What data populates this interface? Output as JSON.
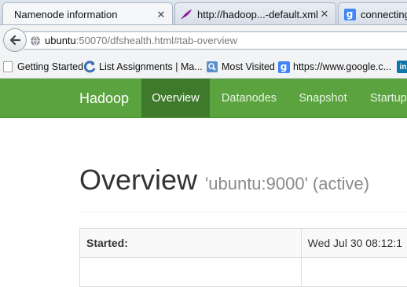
{
  "browser": {
    "tabs": [
      {
        "label": "Namenode information",
        "icon": "none",
        "active": true
      },
      {
        "label": "http://hadoop...-default.xml",
        "icon": "feather-icon",
        "active": false
      },
      {
        "label": "connecting",
        "icon": "google-icon",
        "active": false
      }
    ],
    "close_glyph": "✕",
    "url": {
      "host": "ubuntu",
      "rest": ":50070/dfshealth.html#tab-overview"
    },
    "bookmarks": [
      {
        "label": "Getting Started",
        "icon": "page-icon"
      },
      {
        "label": "List Assignments | Ma...",
        "icon": "swirl-icon"
      },
      {
        "label": "Most Visited",
        "icon": "magnifier-icon"
      },
      {
        "label": "https://www.google.c...",
        "icon": "google-icon"
      }
    ],
    "google_letter": "g",
    "truncated_bookmark_badge": "in"
  },
  "app": {
    "brand": "Hadoop",
    "nav": [
      {
        "label": "Overview",
        "active": true
      },
      {
        "label": "Datanodes",
        "active": false
      },
      {
        "label": "Snapshot",
        "active": false
      },
      {
        "label": "Startup",
        "active": false
      }
    ],
    "colors": {
      "navbar": "#5aa33f",
      "navbar_active": "#3f7a2c"
    }
  },
  "overview": {
    "title": "Overview",
    "subtitle": "'ubuntu:9000' (active)",
    "rows": [
      {
        "key": "Started:",
        "value": "Wed Jul 30 08:12:1"
      },
      {
        "key": "",
        "value": ""
      }
    ]
  }
}
